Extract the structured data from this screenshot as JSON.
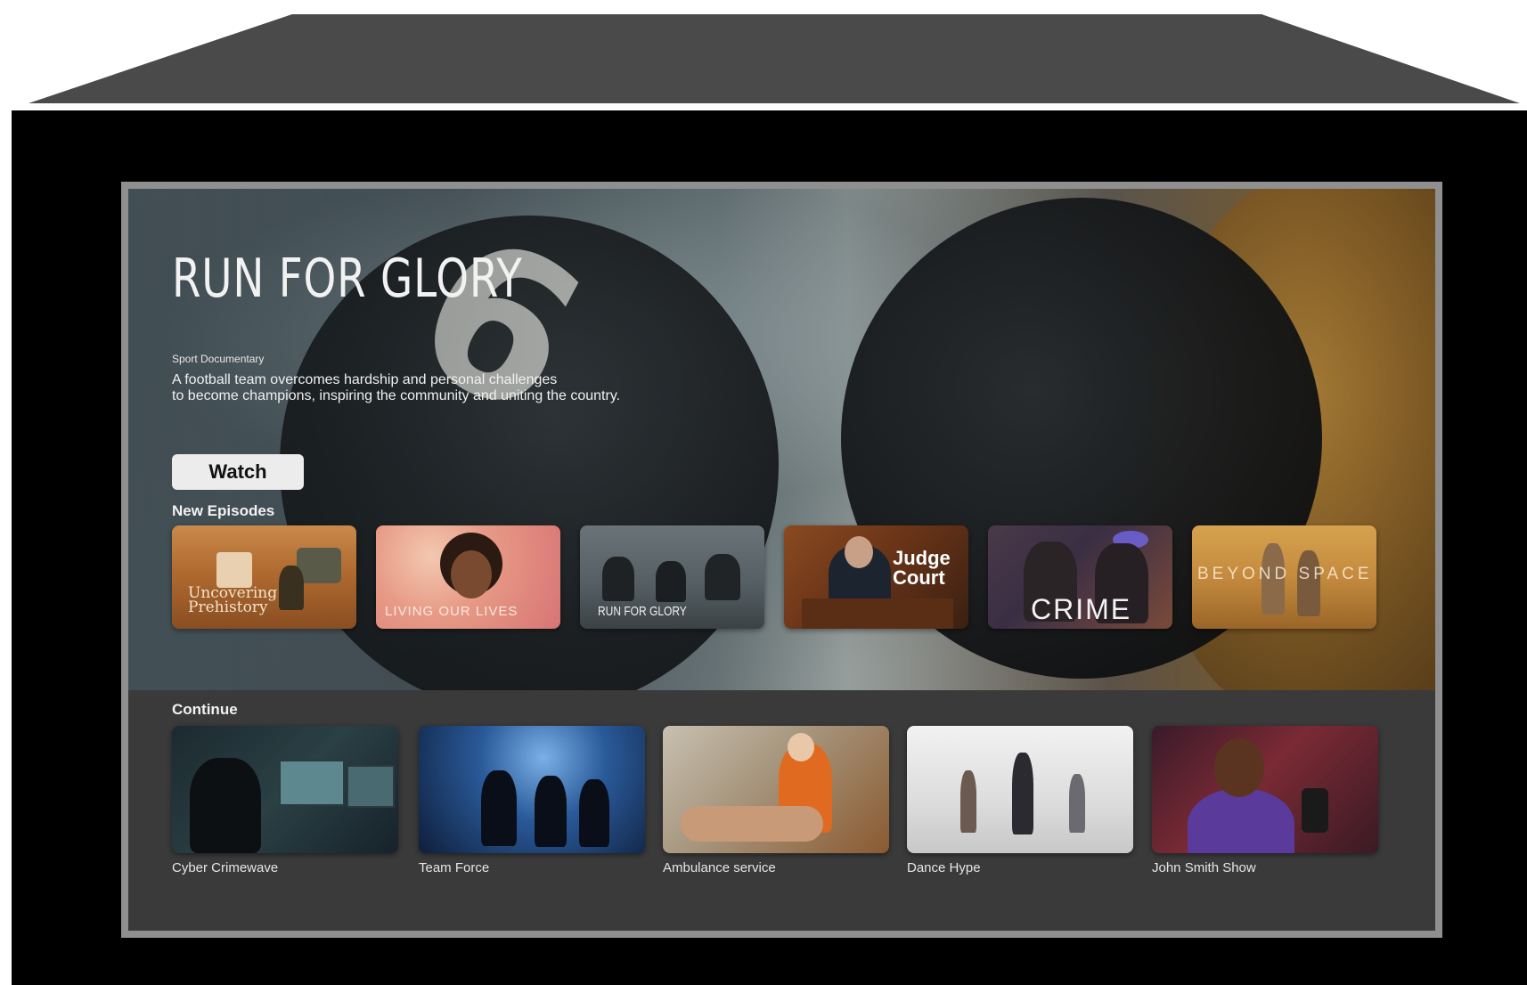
{
  "hero": {
    "title": "RUN FOR GLORY",
    "genre": "Sport Documentary",
    "description_line1": "A football team overcomes hardship and personal challenges",
    "description_line2": "to become champions, inspiring the community and uniting the country.",
    "watch_label": "Watch"
  },
  "new_episodes": {
    "label": "New Episodes",
    "items": [
      {
        "caption": "Uncovering Prehistory"
      },
      {
        "caption": "LIVING OUR LIVES"
      },
      {
        "caption": "RUN FOR GLORY"
      },
      {
        "caption": "Judge Court"
      },
      {
        "caption": "CRIME"
      },
      {
        "caption": "BEYOND SPACE"
      }
    ]
  },
  "continue": {
    "label": "Continue",
    "items": [
      {
        "title": "Cyber Crimewave"
      },
      {
        "title": "Team Force"
      },
      {
        "title": "Ambulance service"
      },
      {
        "title": "Dance Hype"
      },
      {
        "title": "John Smith Show"
      }
    ]
  },
  "colors": {
    "tv_frame": "#000000",
    "screen_border": "#8f8f8f",
    "roof": "#4a4a4a",
    "watch_button": "#ececec"
  }
}
